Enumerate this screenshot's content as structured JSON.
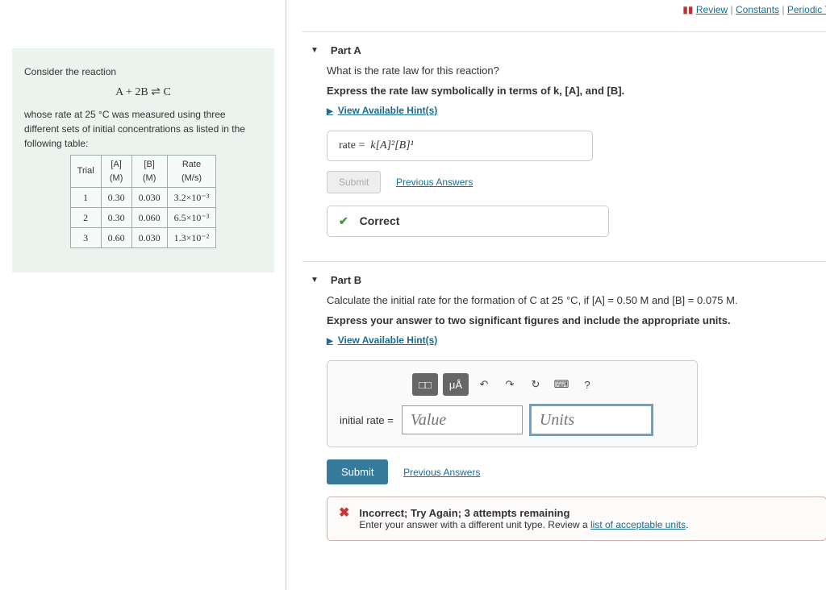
{
  "top_links": {
    "review": "Review",
    "constants": "Constants",
    "periodic": "Periodic Ta"
  },
  "problem": {
    "intro": "Consider the reaction",
    "equation": "A + 2B ⇌ C",
    "desc1": "whose rate at 25 °C was measured using three different sets of initial concentrations as listed in the following table:",
    "headers": {
      "trial": "Trial",
      "a": "[A]",
      "a_unit": "(M)",
      "b": "[B]",
      "b_unit": "(M)",
      "rate": "Rate",
      "rate_unit": "(M/s)"
    },
    "rows": [
      {
        "trial": "1",
        "a": "0.30",
        "b": "0.030",
        "rate": "3.2×10⁻³"
      },
      {
        "trial": "2",
        "a": "0.30",
        "b": "0.060",
        "rate": "6.5×10⁻³"
      },
      {
        "trial": "3",
        "a": "0.60",
        "b": "0.030",
        "rate": "1.3×10⁻²"
      }
    ]
  },
  "partA": {
    "title": "Part A",
    "question": "What is the rate law for this reaction?",
    "instruction": "Express the rate law symbolically in terms of k, [A], and [B].",
    "hint": "View Available Hint(s)",
    "answer_prefix": "rate =",
    "answer_value": "k[A]²[B]¹",
    "submit": "Submit",
    "prev": "Previous Answers",
    "feedback": "Correct"
  },
  "partB": {
    "title": "Part B",
    "question": "Calculate the initial rate for the formation of C at 25 °C, if [A] = 0.50 M and [B] = 0.075 M.",
    "instruction": "Express your answer to two significant figures and include the appropriate units.",
    "hint": "View Available Hint(s)",
    "toolbar": {
      "tmpl": "□□",
      "units": "μÅ",
      "undo": "↶",
      "redo": "↷",
      "reset": "↻",
      "keyboard": "⌨",
      "help": "?"
    },
    "input_label": "initial rate =",
    "value_placeholder": "Value",
    "units_placeholder": "Units",
    "submit": "Submit",
    "prev": "Previous Answers",
    "feedback_title": "Incorrect; Try Again; 3 attempts remaining",
    "feedback_body": "Enter your answer with a different unit type. Review a ",
    "feedback_link": "list of acceptable units",
    "feedback_after": "."
  }
}
